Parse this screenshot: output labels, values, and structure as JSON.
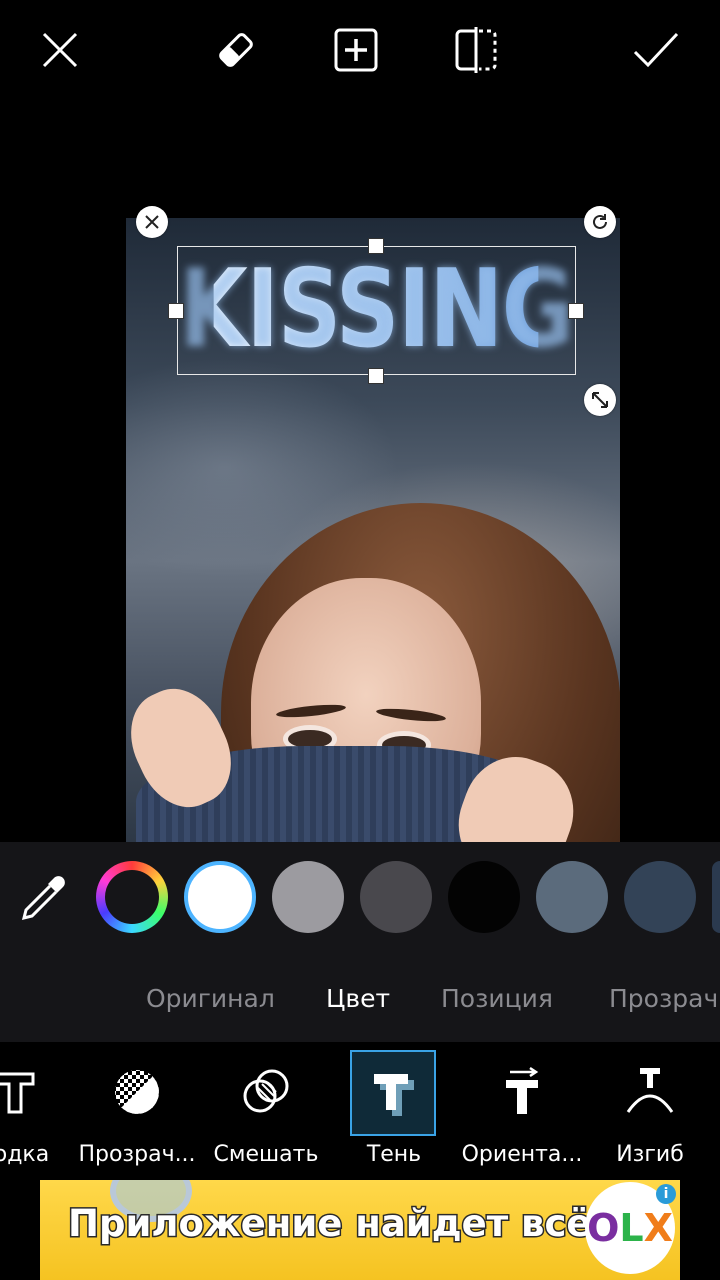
{
  "toolbar": {
    "close_icon": "close-icon",
    "eraser_icon": "eraser-icon",
    "add_icon": "add-layer-icon",
    "compare_icon": "compare-icon",
    "apply_icon": "checkmark-icon"
  },
  "canvas": {
    "text_sticker": "KISSING"
  },
  "palette": {
    "picker_icon": "eyedropper-icon",
    "swatches": [
      {
        "name": "color-wheel",
        "color": "rainbow"
      },
      {
        "name": "white",
        "color": "#ffffff",
        "selected": true
      },
      {
        "name": "light-gray",
        "color": "#9c9ba0"
      },
      {
        "name": "dark-gray",
        "color": "#49484d"
      },
      {
        "name": "black",
        "color": "#030303"
      },
      {
        "name": "slate",
        "color": "#5b6b7c"
      },
      {
        "name": "navy-slate",
        "color": "#334357"
      },
      {
        "name": "partial",
        "color": "#2b3a4f"
      }
    ]
  },
  "modes": {
    "tabs": [
      "Оригинал",
      "Цвет",
      "Позиция",
      "Прозрач"
    ],
    "active": "Цвет"
  },
  "tools": {
    "items": [
      {
        "label": "водка",
        "icon": "stroke-text-icon"
      },
      {
        "label": "Прозрач...",
        "icon": "opacity-icon"
      },
      {
        "label": "Смешать",
        "icon": "blend-icon"
      },
      {
        "label": "Тень",
        "icon": "shadow-text-icon",
        "active": true
      },
      {
        "label": "Ориента...",
        "icon": "orientation-icon"
      },
      {
        "label": "Изгиб",
        "icon": "bend-icon"
      }
    ]
  },
  "ad": {
    "text": "Приложение найдет всё!",
    "brand": "OLX",
    "info": "i"
  }
}
